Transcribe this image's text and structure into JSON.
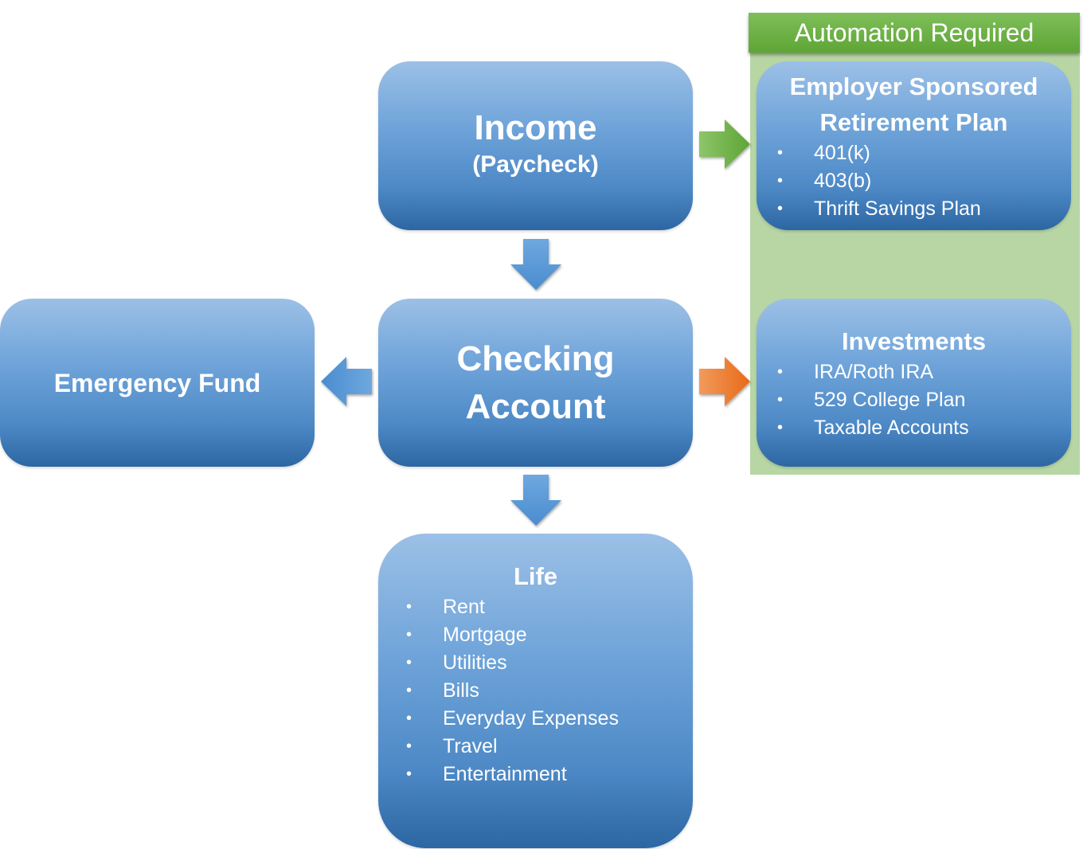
{
  "automation": {
    "header": "Automation Required",
    "header_color": "#6aae40",
    "panel_color": "#b7d6a4"
  },
  "income": {
    "title": "Income",
    "subtitle": "(Paycheck)"
  },
  "checking": {
    "line1": "Checking",
    "line2": "Account"
  },
  "emergency": {
    "title": "Emergency Fund"
  },
  "retirement": {
    "title_line1": "Employer Sponsored",
    "title_line2": "Retirement Plan",
    "items": [
      "401(k)",
      "403(b)",
      "Thrift Savings Plan"
    ]
  },
  "investments": {
    "title": "Investments",
    "items": [
      "IRA/Roth IRA",
      "529 College Plan",
      "Taxable Accounts"
    ]
  },
  "life": {
    "title": "Life",
    "items": [
      "Rent",
      "Mortgage",
      "Utilities",
      "Bills",
      "Everyday Expenses",
      "Travel",
      "Entertainment"
    ]
  },
  "bullet_glyph": "•",
  "arrows": {
    "income_to_retirement": {
      "direction": "right",
      "color": "#6aae40",
      "icon": "arrow-right"
    },
    "income_to_checking": {
      "direction": "down",
      "color": "#4f8fcf",
      "icon": "arrow-down"
    },
    "checking_to_emergency": {
      "direction": "left",
      "color": "#4f8fcf",
      "icon": "arrow-left"
    },
    "checking_to_investments": {
      "direction": "right",
      "color": "#ee7a2a",
      "icon": "arrow-right"
    },
    "checking_to_life": {
      "direction": "down",
      "color": "#4f8fcf",
      "icon": "arrow-down"
    }
  }
}
